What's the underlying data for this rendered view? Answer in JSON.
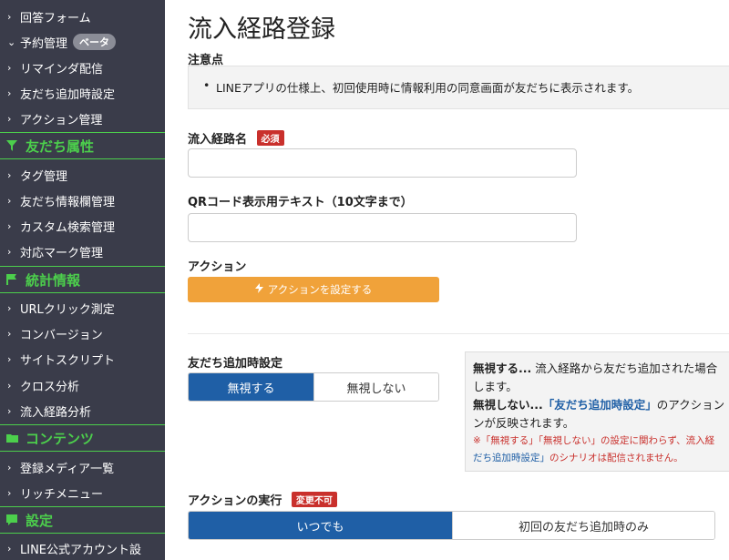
{
  "sidebar": {
    "items": [
      {
        "label": "回答フォーム",
        "chev": "›"
      },
      {
        "label": "予約管理",
        "chev": "⌄",
        "badge": "ベータ"
      },
      {
        "label": "リマインダ配信",
        "chev": "›"
      },
      {
        "label": "友だち追加時設定",
        "chev": "›"
      },
      {
        "label": "アクション管理",
        "chev": "›"
      }
    ],
    "sections": [
      {
        "label": "友だち属性",
        "icon": "filter-icon",
        "items": [
          "タグ管理",
          "友だち情報欄管理",
          "カスタム検索管理",
          "対応マーク管理"
        ]
      },
      {
        "label": "統計情報",
        "icon": "flag-icon",
        "items": [
          "URLクリック測定",
          "コンバージョン",
          "サイトスクリプト",
          "クロス分析",
          "流入経路分析"
        ]
      },
      {
        "label": "コンテンツ",
        "icon": "folder-icon",
        "items": [
          "登録メディア一覧",
          "リッチメニュー"
        ]
      },
      {
        "label": "設定",
        "icon": "chat-icon",
        "items": [
          "LINE公式アカウント設"
        ]
      }
    ],
    "accent_color": "#4ccf4c"
  },
  "main": {
    "title": "流入経路登録",
    "notice_label": "注意点",
    "notice_text": "LINEアプリの仕様上、初回使用時に情報利用の同意画面が友だちに表示されます。",
    "route_name_label": "流入経路名",
    "required_badge": "必須",
    "route_name_value": "",
    "qr_label": "QRコード表示用テキスト（10文字まで）",
    "qr_value": "",
    "action_label": "アクション",
    "action_button": "アクションを設定する",
    "friend_add_label": "友だち追加時設定",
    "friend_add_options": [
      "無視する",
      "無視しない"
    ],
    "friend_add_selected": "無視する",
    "info": {
      "line1_b": "無視する...",
      "line1": " 流入経路から友だち追加された場合",
      "line2": "します。",
      "line3_b": "無視しない...",
      "line3_link": "「友だち追加時設定」",
      "line3": "のアクション",
      "line4": "ンが反映されます。",
      "note1": "※「無視する」「無視しない」の設定に関わらず、流入経",
      "note2_link": "だち追加時設定」",
      "note2": "のシナリオは配信されません。"
    },
    "exec_label": "アクションの実行",
    "exec_badge": "変更不可",
    "exec_options": [
      "いつでも",
      "初回の友だち追加時のみ"
    ],
    "exec_selected": "いつでも"
  },
  "colors": {
    "primary": "#1f5fa6",
    "orange": "#f0a23a",
    "red": "#c9302c",
    "sidebar_bg": "#3a3c4a"
  }
}
